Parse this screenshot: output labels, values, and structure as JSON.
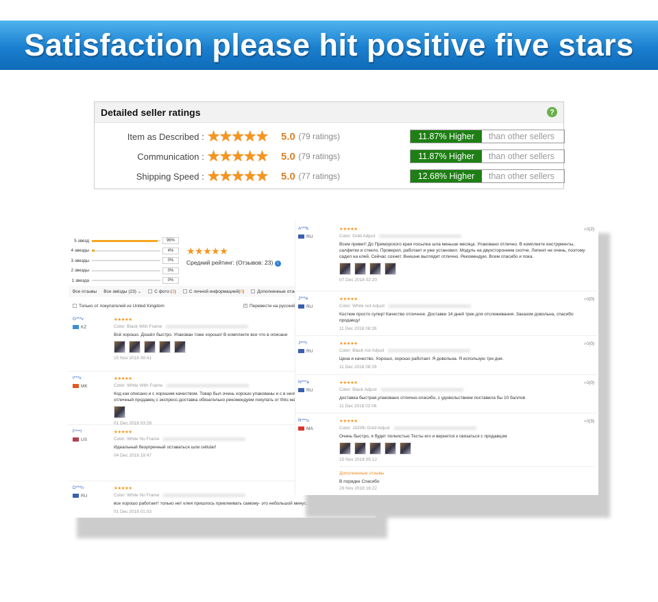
{
  "banner": {
    "title": "Satisfaction please hit positive five stars"
  },
  "seller_ratings": {
    "title": "Detailed seller ratings",
    "help_icon": "question-icon",
    "rows": [
      {
        "label": "Item as Described :",
        "score": "5.0",
        "count": "(79 ratings)",
        "stars": 5,
        "higher": "11.87% Higher",
        "than": "than other sellers"
      },
      {
        "label": "Communication :",
        "score": "5.0",
        "count": "(79 ratings)",
        "stars": 5,
        "higher": "11.87% Higher",
        "than": "than other sellers"
      },
      {
        "label": "Shipping Speed :",
        "score": "5.0",
        "count": "(77 ratings)",
        "stars": 5,
        "higher": "12.68% Higher",
        "than": "than other sellers"
      }
    ],
    "colors": {
      "higher_bg": "#1e7f14",
      "stars": "#f7941d"
    }
  },
  "left_panel": {
    "histogram": [
      {
        "label": "5 звезд",
        "pct": "96%",
        "value": 96
      },
      {
        "label": "4 звезды",
        "pct": "4%",
        "value": 4
      },
      {
        "label": "3 звезды",
        "pct": "0%",
        "value": 0
      },
      {
        "label": "2 звезды",
        "pct": "0%",
        "value": 0
      },
      {
        "label": "1 звезда",
        "pct": "0%",
        "value": 0
      }
    ],
    "avg_stars": "★★★★★",
    "avg_label": "Средний рейтинг:  (Отзывов: 23)",
    "filters": {
      "all": "Все отзывы",
      "stars": "Все звёзды (23)",
      "photo": "С фото (",
      "photo_n": "3",
      "photo_end": ")",
      "personal": "С личной информацией(",
      "personal_n": "0",
      "personal_end": ")",
      "added": "Дополненные отзы",
      "uk": "Только от покупателей из United Kingdom",
      "translate": "Перевести на русский"
    },
    "reviews": [
      {
        "name": "G***v",
        "country": "KZ",
        "flag": "#3b8fd0",
        "stars": "★★★★★",
        "color": "Color: Black With Frame",
        "text": "Всё хорошо. Дошёл быстро. Упакован тоже хорошо! В комплекте все что в описани",
        "photos": 5,
        "date": "15 Nov 2018 08:41"
      },
      {
        "name": "I***v",
        "country": "MK",
        "flag": "#e2561f",
        "stars": "★★★★★",
        "color": "Color: White With Frame",
        "text": "Код как описано и с хорошим качеством. Товар был очень хорошо упакованы и с в необходимые, чтобы заменить экран. Это отличный продавец с экспресс-доставка обязательно рекомендуем покупать от thks магазине",
        "photos": 1,
        "date": "01 Dec 2018 03:29"
      },
      {
        "name": "F***l",
        "country": "US",
        "flag": "#b04050",
        "stars": "★★★★★",
        "color": "Color: White No Frame",
        "text": "Идеальный безупречный оставаться шли cellular!",
        "photos": 0,
        "date": "04 Dec 2018 19:47"
      },
      {
        "name": "D***n",
        "country": "RU",
        "flag": "#3a5fb0",
        "stars": "★★★★★",
        "color": "Color: White No Frame",
        "text": "все хорошо работает! только нет клея пришлось приклеивать самому- это небольшой минус, пришло очень быстро",
        "photos": 0,
        "date": "01 Dec 2018 01:03"
      }
    ]
  },
  "right_panel": {
    "reviews": [
      {
        "name": "A***k",
        "country": "RU",
        "flag": "#3a5fb0",
        "stars": "★★★★★",
        "color": "Color: Gold Adjust",
        "text": "Всем привет! До Приморского края посылка шла меньше месяца. Упаковано отлично. В комплекте инструменты, салфетки и стекло. Проверил, работает и уже установил. Модуль на двухстороннем скотче. Липнит не очень, поэтому садил на клей. Сейчас сохнет. Внешне выглядит отлично. Рекомендую. Всем спасибо и пока.",
        "photos": 4,
        "date": "07 Dec 2018 02:20",
        "likes": "(2)"
      },
      {
        "name": "J***e",
        "country": "RU",
        "flag": "#3a5fb0",
        "stars": "★★★★★",
        "color": "Color: White not Adjust",
        "text": "Костюм просто супер! Качество отличное. Доставки 14 дней трек для отслеживания. Заказом довольна, спасибо продавцу!",
        "photos": 0,
        "date": "11 Dec 2018 08:26",
        "likes": "(0)"
      },
      {
        "name": "J***r",
        "country": "RU",
        "flag": "#3a5fb0",
        "stars": "★★★★★",
        "color": "Color: Black not Adjust",
        "text": "Цена и качество. Хорошо, хорошо работает. Я довольна. Я использую три дня.",
        "photos": 0,
        "date": "11 Dec 2018 08:29",
        "likes": "(0)"
      },
      {
        "name": "N***a",
        "country": "RU",
        "flag": "#3a5fb0",
        "stars": "★★★★★",
        "color": "Color: Black Adjust",
        "text": "доставка быстрая,упаковано отлично-спасибо, с удовольствием поставила бы 10 баллов",
        "photos": 0,
        "date": "11 Dec 2018 02:06",
        "likes": "(0)"
      },
      {
        "name": "R***u",
        "country": "MA",
        "flag": "#d8382e",
        "stars": "★★★★★",
        "color": "Color: J320fn Gold Adjust",
        "text": "Очень быстро, я будет полностью Тесты его и вернется к связаться с продавцом",
        "photos": 5,
        "date": "15 Nov 2018 05:12",
        "likes": "(3)",
        "additional_label": "Дополненные отзывы",
        "additional_text": "В порядке Спасибо",
        "additional_date": "29 Nov 2018 16:22"
      }
    ]
  }
}
